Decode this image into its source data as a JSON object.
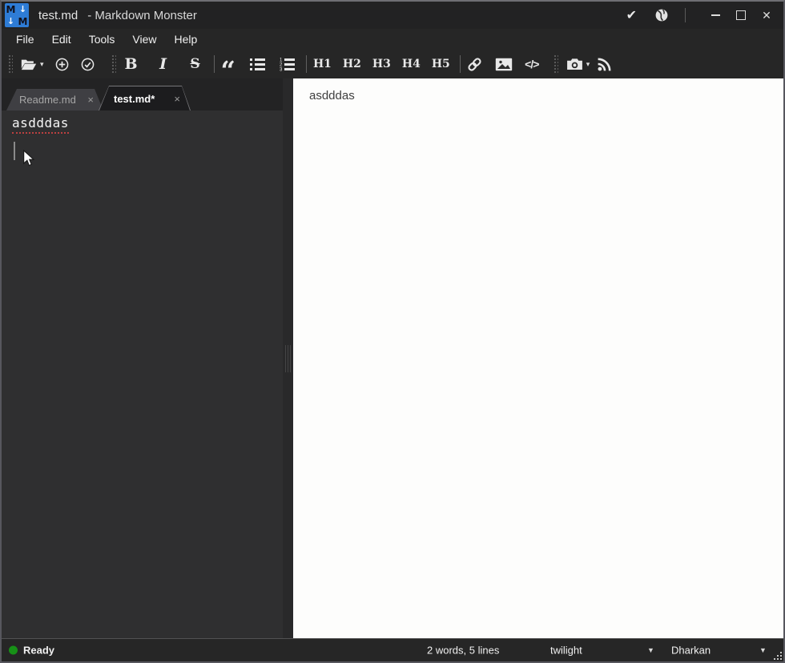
{
  "window": {
    "logo": {
      "m1": "M",
      "a1": "↓",
      "a2": "↓",
      "m2": "M"
    },
    "title_doc": "test.md",
    "title_app": "- Markdown Monster"
  },
  "menu": {
    "items": [
      "File",
      "Edit",
      "Tools",
      "View",
      "Help"
    ]
  },
  "toolbar": {
    "bold": "B",
    "italic": "I",
    "strike": "S",
    "quote": "“",
    "headings": [
      "H1",
      "H2",
      "H3",
      "H4",
      "H5"
    ],
    "code": "</>"
  },
  "tabs": [
    {
      "label": "Readme.md",
      "close_label": "×",
      "active": false
    },
    {
      "label": "test.md*",
      "close_label": "×",
      "active": true
    }
  ],
  "editor": {
    "content": "asdddas"
  },
  "preview": {
    "content": "asdddas"
  },
  "statusbar": {
    "status": "Ready",
    "word_count": "2 words, 5 lines",
    "preview_theme": "twilight",
    "editor_theme": "Dharkan"
  },
  "icons": {
    "check": "✔",
    "close": "✕",
    "caret": "▾",
    "dropdown": "▼"
  },
  "colors": {
    "logo_blue": "#2e7cd6",
    "chrome_bg": "#262626",
    "editor_bg": "#2f2f30",
    "preview_bg": "#fdfdfc",
    "status_green": "#179117",
    "spellcheck_red": "#bb4040"
  }
}
